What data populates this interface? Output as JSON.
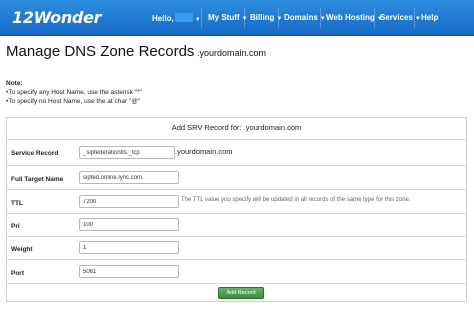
{
  "nav": {
    "logo": "12Wonder",
    "items": [
      {
        "label": "Hello,",
        "has_caret": true
      },
      {
        "label": "My Stuff",
        "has_caret": true
      },
      {
        "label": "Billing",
        "has_caret": true
      },
      {
        "label": "Domains",
        "has_caret": true
      },
      {
        "label": "Web Hosting",
        "has_caret": true
      },
      {
        "label": "Services",
        "has_caret": true
      },
      {
        "label": "Help",
        "has_caret": false
      }
    ]
  },
  "page": {
    "title": "Manage DNS Zone Records",
    "domain": " .yourdomain.com"
  },
  "note": {
    "heading": "Note:",
    "line1": "•To specify any Host Name, use the asterisk \"*\"",
    "line2": "•To specify no Host Name, use the at char \"@\""
  },
  "form": {
    "title": "Add SRV Record for: .yourdomain.com",
    "service_record": {
      "label": "Service Record",
      "value": "_sipfederationtls._tcp",
      "suffix": ".yourdomain.com"
    },
    "full_target_name": {
      "label": "Full Target Name",
      "value": "sipfed.online.lync.com."
    },
    "ttl": {
      "label": "TTL",
      "value": "7200",
      "hint": "The TTL value you specify will be updated in all records of the same type for this zone."
    },
    "pri": {
      "label": "Pri",
      "value": "100"
    },
    "weight": {
      "label": "Weight",
      "value": "1"
    },
    "port": {
      "label": "Port",
      "value": "5061"
    },
    "submit_label": "Add Record"
  },
  "colors": {
    "navbar": "#1f7fd6",
    "button": "#4cae4c"
  }
}
